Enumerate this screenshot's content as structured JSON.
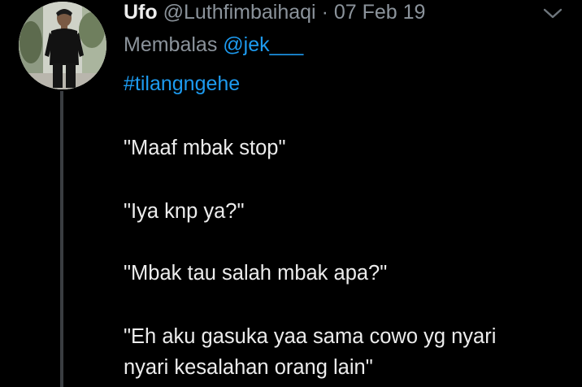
{
  "tweet": {
    "display_name": "Ufo",
    "handle": "@Luthfimbaihaqi",
    "separator": "·",
    "date": "07 Feb 19",
    "reply_prefix": "Membalas",
    "reply_to": "@jek___",
    "hashtag": "#tilangngehe",
    "lines": [
      "\"Maaf mbak stop\"",
      "\"Iya knp ya?\"",
      "\"Mbak tau salah mbak apa?\"",
      "\"Eh aku gasuka yaa sama cowo yg nyari",
      "nyari kesalahan orang lain\""
    ]
  },
  "icons": {
    "avatar": "profile-photo",
    "menu": "chevron-down-icon"
  },
  "colors": {
    "background": "#000000",
    "link": "#1d9bf0",
    "muted": "#8b939b",
    "text": "#ececec",
    "thread_line": "#3a3d41"
  }
}
